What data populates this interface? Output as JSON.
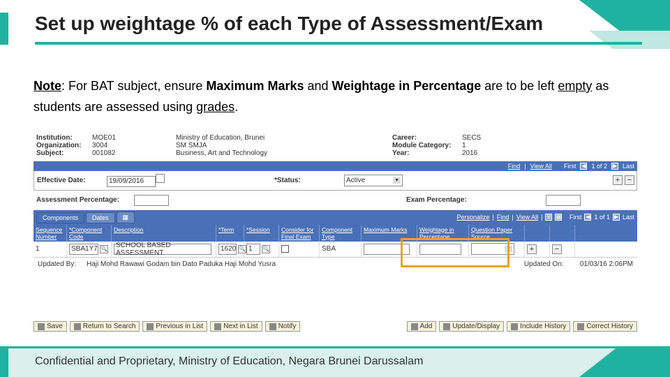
{
  "title": "Set up weightage % of each Type of Assessment/Exam",
  "note": {
    "pre": "Note",
    "t1": ": For BAT subject, ensure ",
    "b1": "Maximum Marks",
    "t2": " and ",
    "b2": "Weightage in Percentage",
    "t3": " are to be left ",
    "u1": "empty",
    "t4": " as students are assessed using ",
    "u2": "grades",
    "t5": "."
  },
  "hdr": {
    "institution_l": "Institution:",
    "institution": "MOE01",
    "ministry": "Ministry of Education, Brunei",
    "career_l": "Career:",
    "career": "SECS",
    "organization_l": "Organization:",
    "organization": "3004",
    "school": "SM SMJA",
    "module_cat_l": "Module Category:",
    "module_cat": "1",
    "subject_l": "Subject:",
    "subject": "001082",
    "subject_name": "Business, Art and Technology",
    "year_l": "Year:",
    "year": "2016"
  },
  "barA": {
    "find": "Find",
    "view": "View All",
    "first": "First",
    "pos": "1 of 2",
    "last": "Last"
  },
  "row1": {
    "eff_l": "Effective Date:",
    "eff": "19/09/2016",
    "status_l": "*Status:",
    "status": "Active",
    "add": "+",
    "del": "−"
  },
  "row2": {
    "assess_l": "Assessment Percentage:",
    "assess": "",
    "exam_l": "Exam Percentage:",
    "exam": ""
  },
  "barB": {
    "personalize": "Personalize",
    "find": "Find",
    "view": "View All",
    "first": "First",
    "pos": "1 of 1",
    "last": "Last"
  },
  "tabs": {
    "components": "Components",
    "dates": "Dates",
    "expand": "▦"
  },
  "cols": {
    "seq": "Sequence Number",
    "code": "*Component Code",
    "desc": "Description",
    "term": "*Term",
    "session": "*Session",
    "consider": "Consider for Final Exam",
    "type": "Component Type",
    "max": "Maximum Marks",
    "weight": "Weightage in Percentage",
    "source": "Question Paper Source"
  },
  "data": {
    "seq": "1",
    "code": "SBA1Y7",
    "desc": "SCHOOL BASED ASSESSMENT",
    "term": "1620",
    "session": "1",
    "type": "SBA",
    "max": "",
    "weight": "",
    "source": ""
  },
  "upd": {
    "by_l": "Updated By:",
    "by": "Haji Mohd Rawawi Godam bin Dato Paduka Haji Mohd Yusra",
    "on_l": "Updated On:",
    "on": "01/03/16  2:06PM"
  },
  "btns": {
    "save": "Save",
    "return": "Return to Search",
    "prev": "Previous in List",
    "next": "Next in List",
    "notify": "Notify",
    "add": "Add",
    "update": "Update/Display",
    "include": "Include History",
    "correct": "Correct History"
  },
  "footer": "Confidential and Proprietary, Ministry of Education, Negara Brunei Darussalam"
}
